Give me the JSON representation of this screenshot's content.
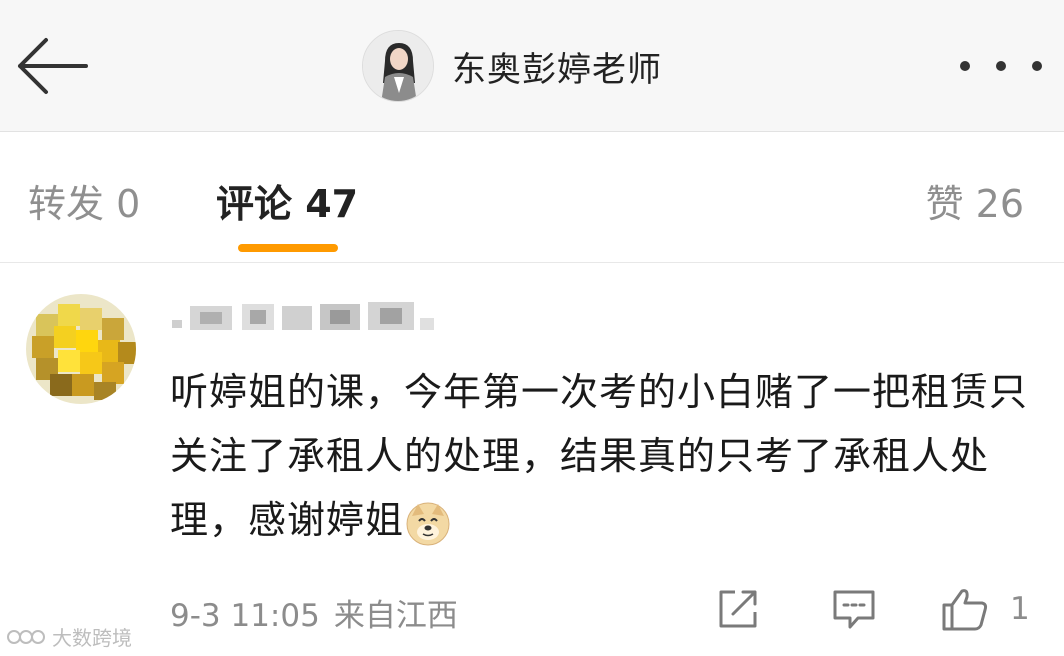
{
  "header": {
    "title": "东奥彭婷老师",
    "back_icon": "arrow-left-icon",
    "more_icon": "more-dots-icon"
  },
  "tabs": {
    "repost": "转发 0",
    "comments": "评论 47",
    "likes": "赞 26",
    "active": "comments",
    "accent_color": "#ff9a00"
  },
  "comment": {
    "text": "听婷姐的课，今年第一次考的小白赌了一把租赁只关注了承租人的处理，结果真的只考了承租人处理，感谢婷姐",
    "emoji": "doge-emoji-icon",
    "date": "9-3 11:05",
    "location": "来自江西",
    "like_count": "1",
    "actions": [
      "share-icon",
      "reply-icon",
      "thumbs-up-icon"
    ]
  },
  "watermark": {
    "text": "大数跨境"
  }
}
